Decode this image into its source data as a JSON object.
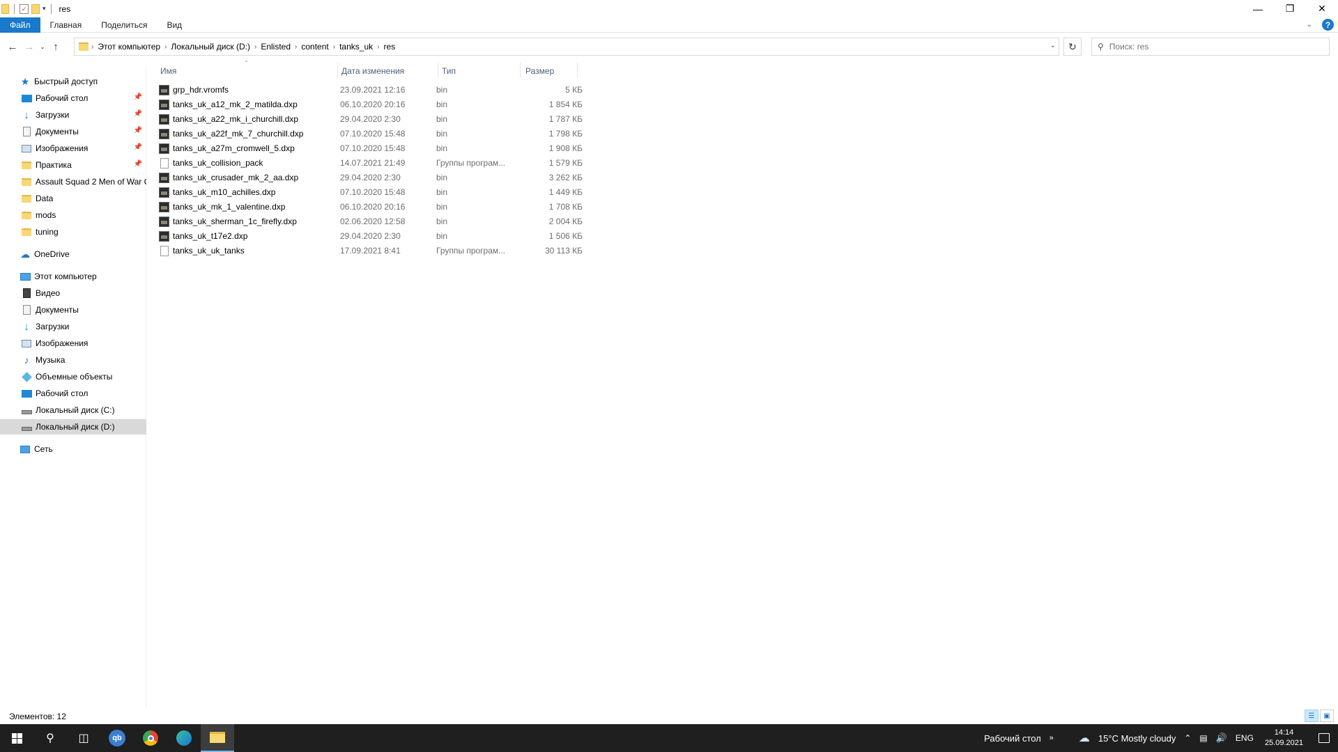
{
  "window": {
    "title": "res",
    "controls": [
      "minimize",
      "maximize",
      "close"
    ]
  },
  "ribbon": {
    "tabs": [
      "Файл",
      "Главная",
      "Поделиться",
      "Вид"
    ]
  },
  "address": {
    "crumbs": [
      "Этот компьютер",
      "Локальный диск (D:)",
      "Enlisted",
      "content",
      "tanks_uk",
      "res"
    ]
  },
  "search": {
    "placeholder": "Поиск: res"
  },
  "navpane": {
    "quick_access": "Быстрый доступ",
    "quick_items": [
      "Рабочий стол",
      "Загрузки",
      "Документы",
      "Изображения",
      "Практика",
      "Assault Squad 2 Men of War C",
      "Data",
      "mods",
      "tuning"
    ],
    "onedrive": "OneDrive",
    "this_pc": "Этот компьютер",
    "pc_items": [
      "Видео",
      "Документы",
      "Загрузки",
      "Изображения",
      "Музыка",
      "Объемные объекты",
      "Рабочий стол",
      "Локальный диск (C:)",
      "Локальный диск (D:)"
    ],
    "network": "Сеть"
  },
  "columns": {
    "name": "Имя",
    "date": "Дата изменения",
    "type": "Тип",
    "size": "Размер"
  },
  "files": [
    {
      "name": "grp_hdr.vromfs",
      "date": "23.09.2021 12:16",
      "type": "bin",
      "size": "5 КБ",
      "icon": "image-file"
    },
    {
      "name": "tanks_uk_a12_mk_2_matilda.dxp",
      "date": "06.10.2020 20:16",
      "type": "bin",
      "size": "1 854 КБ",
      "icon": "image-file"
    },
    {
      "name": "tanks_uk_a22_mk_i_churchill.dxp",
      "date": "29.04.2020 2:30",
      "type": "bin",
      "size": "1 787 КБ",
      "icon": "image-file"
    },
    {
      "name": "tanks_uk_a22f_mk_7_churchill.dxp",
      "date": "07.10.2020 15:48",
      "type": "bin",
      "size": "1 798 КБ",
      "icon": "image-file"
    },
    {
      "name": "tanks_uk_a27m_cromwell_5.dxp",
      "date": "07.10.2020 15:48",
      "type": "bin",
      "size": "1 908 КБ",
      "icon": "image-file"
    },
    {
      "name": "tanks_uk_collision_pack",
      "date": "14.07.2021 21:49",
      "type": "Группы програм...",
      "size": "1 579 КБ",
      "icon": "blank-file"
    },
    {
      "name": "tanks_uk_crusader_mk_2_aa.dxp",
      "date": "29.04.2020 2:30",
      "type": "bin",
      "size": "3 262 КБ",
      "icon": "image-file"
    },
    {
      "name": "tanks_uk_m10_achilles.dxp",
      "date": "07.10.2020 15:48",
      "type": "bin",
      "size": "1 449 КБ",
      "icon": "image-file"
    },
    {
      "name": "tanks_uk_mk_1_valentine.dxp",
      "date": "06.10.2020 20:16",
      "type": "bin",
      "size": "1 708 КБ",
      "icon": "image-file"
    },
    {
      "name": "tanks_uk_sherman_1c_firefly.dxp",
      "date": "02.06.2020 12:58",
      "type": "bin",
      "size": "2 004 КБ",
      "icon": "image-file"
    },
    {
      "name": "tanks_uk_t17e2.dxp",
      "date": "29.04.2020 2:30",
      "type": "bin",
      "size": "1 506 КБ",
      "icon": "image-file"
    },
    {
      "name": "tanks_uk_uk_tanks",
      "date": "17.09.2021 8:41",
      "type": "Группы програм...",
      "size": "30 113 КБ",
      "icon": "blank-file"
    }
  ],
  "status": {
    "count": "Элементов: 12"
  },
  "taskbar": {
    "desktop_label": "Рабочий стол",
    "weather": "15°C  Mostly cloudy",
    "lang": "ENG",
    "time": "14:14",
    "date": "25.09.2021"
  },
  "colors": {
    "accent": "#1979ca",
    "selected_nav": "#d9d9d9",
    "taskbar": "#1f1f1f"
  }
}
